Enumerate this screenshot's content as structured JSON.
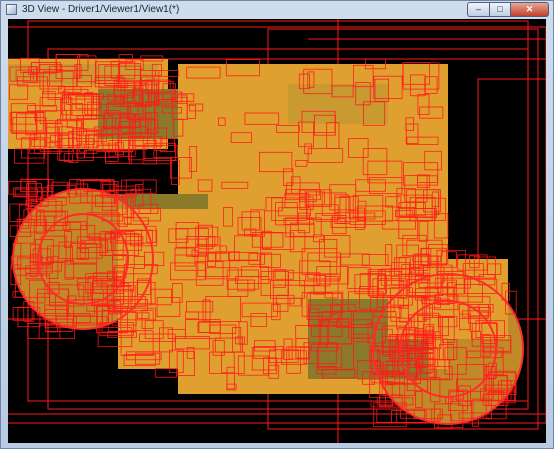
{
  "window": {
    "title": "3D View - Driver1/Viewer1/View1(*)",
    "controls": {
      "minimize": "–",
      "maximize": "□",
      "close": "✕"
    }
  },
  "viewport": {
    "background": "#000000",
    "wire_color": "#ff1a1a",
    "fill_color": "#e0a030",
    "fill_dark": "#8a7a2a"
  }
}
